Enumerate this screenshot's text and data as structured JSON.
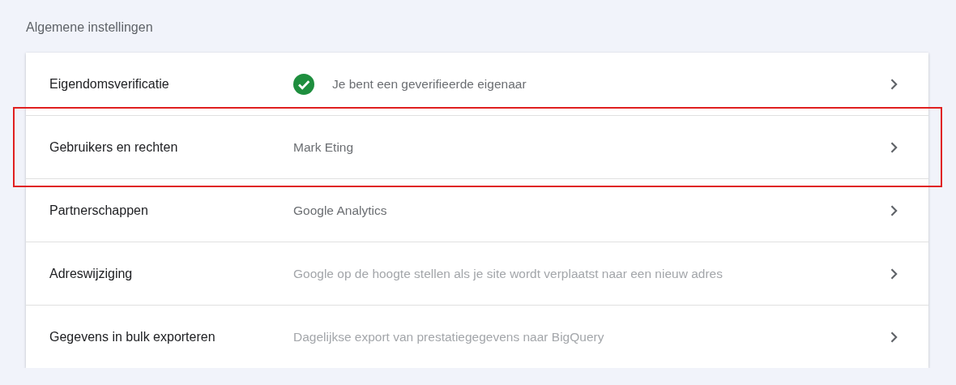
{
  "section_title": "Algemene instellingen",
  "rows": [
    {
      "label": "Eigendomsverificatie",
      "value": "Je bent een geverifieerde eigenaar",
      "verified": true,
      "muted": false,
      "highlighted": false
    },
    {
      "label": "Gebruikers en rechten",
      "value": "Mark Eting",
      "verified": false,
      "muted": false,
      "highlighted": true
    },
    {
      "label": "Partnerschappen",
      "value": "Google Analytics",
      "verified": false,
      "muted": false,
      "highlighted": false
    },
    {
      "label": "Adreswijziging",
      "value": "Google op de hoogte stellen als je site wordt verplaatst naar een nieuw adres",
      "verified": false,
      "muted": true,
      "highlighted": false
    },
    {
      "label": "Gegevens in bulk exporteren",
      "value": "Dagelijkse export van prestatiegegevens naar BigQuery",
      "verified": false,
      "muted": true,
      "highlighted": false
    }
  ]
}
